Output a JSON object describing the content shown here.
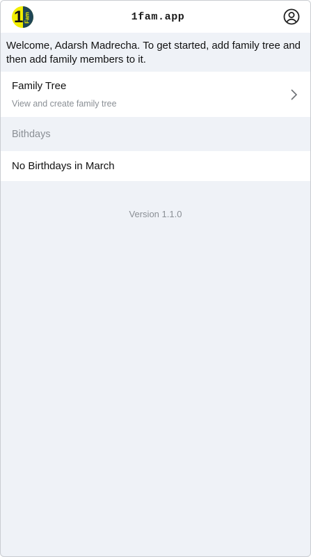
{
  "header": {
    "app_title": "1fam.app",
    "logo_digit": "1",
    "logo_text": "Fam",
    "account_icon": "account-circle-icon"
  },
  "welcome": {
    "message": "Welcome, Adarsh Madrecha. To get started, add family tree and then add family members to it."
  },
  "family_tree": {
    "label": "Family Tree",
    "subtitle": "View and create family tree",
    "chevron_icon": "chevron-right-icon"
  },
  "birthdays": {
    "section_label": "Bithdays",
    "empty_text": "No Birthdays in March"
  },
  "footer": {
    "version": "Version 1.1.0"
  },
  "colors": {
    "background": "#eff2f7",
    "surface": "#ffffff",
    "muted_text": "#8a8f95",
    "logo_yellow": "#f2ee00",
    "logo_teal": "#1f4656"
  }
}
